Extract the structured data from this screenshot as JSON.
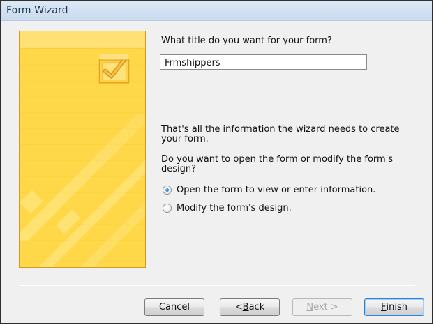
{
  "window": {
    "title": "Form Wizard"
  },
  "content": {
    "title_prompt": "What title do you want for your form?",
    "title_value": "Frmshippers",
    "info": "That's all the information the wizard needs to create your form.",
    "question": "Do you want to open the form or modify the form's design?",
    "options": [
      {
        "label_prefix": "",
        "label_mnemonic": "O",
        "label_suffix": "pen the form to view or enter information.",
        "checked": true
      },
      {
        "label_prefix": "",
        "label_mnemonic": "M",
        "label_suffix": "odify the form's design.",
        "checked": false
      }
    ]
  },
  "buttons": {
    "cancel": "Cancel",
    "back_prefix": "< ",
    "back_mnemonic": "B",
    "back_suffix": "ack",
    "next_prefix": "",
    "next_mnemonic": "N",
    "next_suffix": "ext >",
    "finish_prefix": "",
    "finish_mnemonic": "F",
    "finish_suffix": "inish"
  },
  "colors": {
    "art_panel": "#ffd84a",
    "accent_radio": "#1b78c7",
    "focus_border": "#2a84d6"
  },
  "icons": {
    "wizard_illustration": "check-form-illustration"
  }
}
